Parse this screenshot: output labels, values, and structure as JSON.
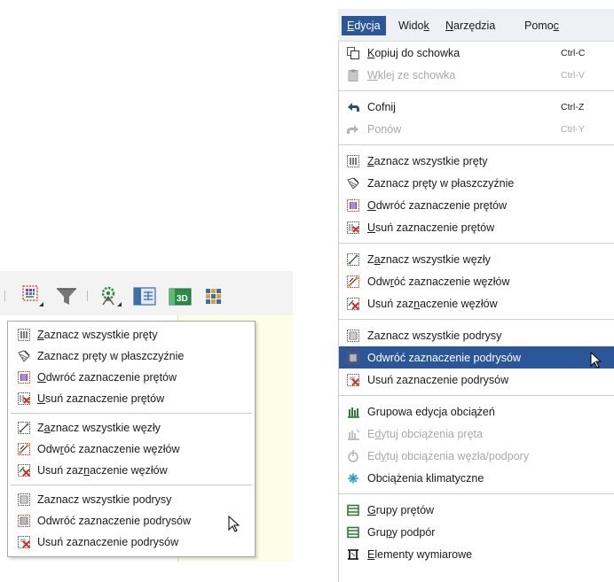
{
  "toolbar": {
    "buttons": [
      {
        "icon": "select-grid-icon"
      },
      {
        "icon": "filter-funnel-icon"
      },
      {
        "icon": "gear-structure-icon"
      },
      {
        "icon": "panel-view-icon"
      },
      {
        "icon": "3d-view-icon",
        "label": "3D"
      },
      {
        "icon": "color-grid-icon"
      }
    ]
  },
  "dropdown": {
    "groups": [
      [
        {
          "pre": "",
          "ul": "Z",
          "post": "aznacz wszystkie pręty",
          "icon": "select-all-bars-icon"
        },
        {
          "pre": "",
          "ul": "",
          "post": "Zaznacz pręty w płaszczyźnie",
          "icon": "select-bars-plane-icon"
        },
        {
          "pre": "",
          "ul": "O",
          "post": "dwróć zaznaczenie prętów",
          "icon": "invert-bars-icon"
        },
        {
          "pre": "",
          "ul": "U",
          "post": "suń zaznaczenie prętów",
          "icon": "clear-bars-icon"
        }
      ],
      [
        {
          "pre": "Z",
          "ul": "a",
          "post": "znacz wszystkie węzły",
          "icon": "select-all-nodes-icon"
        },
        {
          "pre": "Odw",
          "ul": "r",
          "post": "óć zaznaczenie węzłów",
          "icon": "invert-nodes-icon"
        },
        {
          "pre": "Usuń zaz",
          "ul": "n",
          "post": "aczenie węzłów",
          "icon": "clear-nodes-icon"
        }
      ],
      [
        {
          "pre": "",
          "ul": "",
          "post": "Zaznacz wszystkie podrysy",
          "icon": "select-all-sublayers-icon"
        },
        {
          "pre": "",
          "ul": "",
          "post": "Odwróć zaznaczenie podrysów",
          "icon": "invert-sublayers-icon"
        },
        {
          "pre": "",
          "ul": "",
          "post": "Usuń zaznaczenie podrysów",
          "icon": "clear-sublayers-icon"
        }
      ]
    ]
  },
  "menubar": {
    "items": [
      {
        "pre": "",
        "ul": "E",
        "post": "dycja",
        "active": true
      },
      {
        "pre": "Wido",
        "ul": "k",
        "post": "",
        "active": false
      },
      {
        "pre": "",
        "ul": "N",
        "post": "arzędzia",
        "active": false
      },
      {
        "pre": "Pomo",
        "ul": "c",
        "post": "",
        "active": false
      }
    ]
  },
  "menu": {
    "groups": [
      [
        {
          "pre": "",
          "ul": "K",
          "post": "opiuj do schowka",
          "shortcut": "Ctrl-C",
          "icon": "copy-icon",
          "disabled": false
        },
        {
          "pre": "",
          "ul": "W",
          "post": "klej ze schowka",
          "shortcut": "Ctrl-V",
          "icon": "paste-icon",
          "disabled": true
        }
      ],
      [
        {
          "pre": "",
          "ul": "",
          "post": "Cofnij",
          "shortcut": "Ctrl-Z",
          "icon": "undo-icon",
          "disabled": false
        },
        {
          "pre": "",
          "ul": "",
          "post": "Ponów",
          "shortcut": "Ctrl-Y",
          "icon": "redo-icon",
          "disabled": true
        }
      ],
      [
        {
          "pre": "",
          "ul": "Z",
          "post": "aznacz wszystkie pręty",
          "icon": "select-all-bars-icon"
        },
        {
          "pre": "",
          "ul": "",
          "post": "Zaznacz pręty w płaszczyźnie",
          "icon": "select-bars-plane-icon"
        },
        {
          "pre": "",
          "ul": "O",
          "post": "dwróć zaznaczenie prętów",
          "icon": "invert-bars-icon"
        },
        {
          "pre": "",
          "ul": "U",
          "post": "suń zaznaczenie prętów",
          "icon": "clear-bars-icon"
        }
      ],
      [
        {
          "pre": "Z",
          "ul": "a",
          "post": "znacz wszystkie węzły",
          "icon": "select-all-nodes-icon"
        },
        {
          "pre": "Odw",
          "ul": "r",
          "post": "óć zaznaczenie węzłów",
          "icon": "invert-nodes-icon"
        },
        {
          "pre": "Usuń zaz",
          "ul": "n",
          "post": "aczenie węzłów",
          "icon": "clear-nodes-icon"
        }
      ],
      [
        {
          "pre": "",
          "ul": "",
          "post": "Zaznacz wszystkie podrysy",
          "icon": "select-all-sublayers-icon"
        },
        {
          "pre": "",
          "ul": "",
          "post": "Odwróć zaznaczenie podrysów",
          "icon": "invert-sublayers-icon",
          "highlighted": true
        },
        {
          "pre": "",
          "ul": "",
          "post": "Usuń zaznaczenie podrysów",
          "icon": "clear-sublayers-icon"
        }
      ],
      [
        {
          "pre": "",
          "ul": "",
          "post": "Grupowa edycja obciążeń",
          "icon": "group-load-edit-icon"
        },
        {
          "pre": "E",
          "ul": "d",
          "post": "ytuj obciążenia pręta",
          "icon": "bar-load-icon",
          "disabled": true
        },
        {
          "pre": "Ed",
          "ul": "y",
          "post": "tuj obciążenia węzła/podpory",
          "icon": "node-load-icon",
          "disabled": true
        },
        {
          "pre": "",
          "ul": "",
          "post": "Obciążenia klimatyczne",
          "icon": "climate-load-icon"
        }
      ],
      [
        {
          "pre": "",
          "ul": "G",
          "post": "rupy prętów",
          "icon": "bar-groups-icon"
        },
        {
          "pre": "Gru",
          "ul": "p",
          "post": "y podpór",
          "icon": "support-groups-icon"
        },
        {
          "pre": "",
          "ul": "E",
          "post": "lementy wymiarowe",
          "icon": "dimension-elements-icon"
        }
      ]
    ]
  }
}
